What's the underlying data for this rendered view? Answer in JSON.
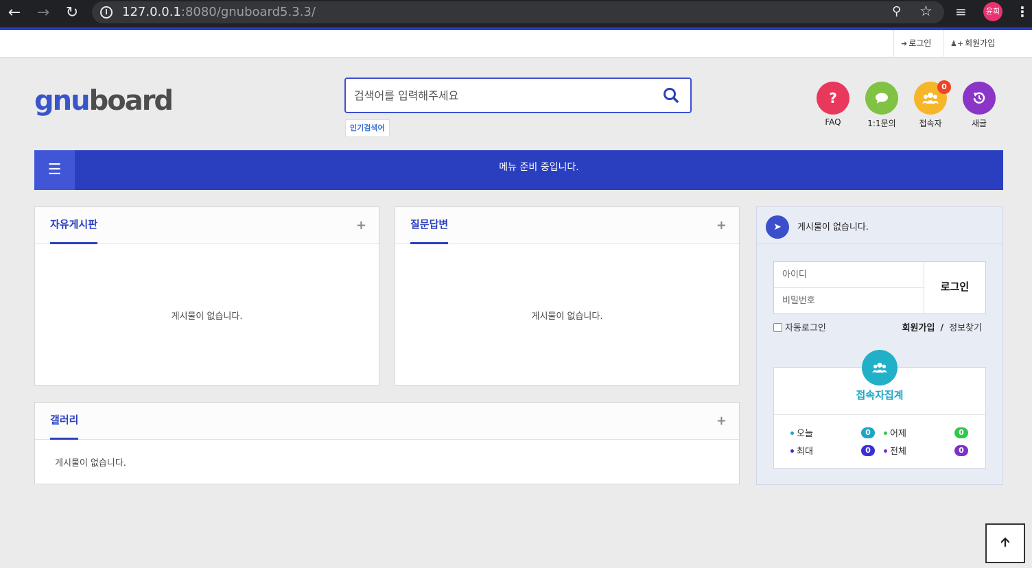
{
  "browser": {
    "url_host": "127.0.0.1",
    "url_rest": ":8080/gnuboard5.3.3/",
    "profile": "윤희"
  },
  "topbar": {
    "login": "로그인",
    "join": "회원가입"
  },
  "logo": {
    "part1": "gnu",
    "part2": "board"
  },
  "search": {
    "placeholder": "검색어를 입력해주세요",
    "popular": "인기검색어"
  },
  "quick_icons": [
    {
      "label": "FAQ",
      "icon": "question-icon",
      "color": "#e8385c"
    },
    {
      "label": "1:1문의",
      "icon": "chat-icon",
      "color": "#80c243"
    },
    {
      "label": "접속자",
      "icon": "users-icon",
      "color": "#f5b62a",
      "badge": "0"
    },
    {
      "label": "새글",
      "icon": "history-icon",
      "color": "#8a35c8"
    }
  ],
  "menu": {
    "message": "메뉴 준비 중입니다."
  },
  "boards": {
    "free": {
      "title": "자유게시판",
      "empty": "게시물이 없습니다."
    },
    "qa": {
      "title": "질문답변",
      "empty": "게시물이 없습니다."
    },
    "gallery": {
      "title": "갤러리",
      "empty": "게시물이 없습니다."
    }
  },
  "side": {
    "notice": "게시물이 없습니다.",
    "id_placeholder": "아이디",
    "pw_placeholder": "비밀번호",
    "login_button": "로그인",
    "auto_login": "자동로그인",
    "join": "회원가입",
    "separator": "/",
    "find_info": "정보찾기"
  },
  "visitors": {
    "title": "접속자집계",
    "today_label": "오늘",
    "today": "0",
    "yesterday_label": "어제",
    "yesterday": "0",
    "max_label": "최대",
    "max": "0",
    "total_label": "전체",
    "total": "0",
    "colors": {
      "today": "#1aa6c5",
      "yesterday": "#2ec94a",
      "max": "#3a2fd6",
      "total": "#7a33c8"
    }
  }
}
